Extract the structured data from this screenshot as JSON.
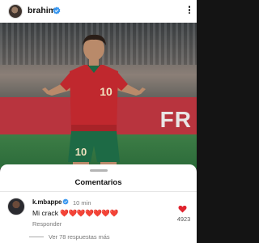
{
  "header": {
    "username": "brahim",
    "avatar_icon": "profile-avatar",
    "verified_icon": "verified-badge-icon",
    "more_icon": "more-vertical-icon"
  },
  "photo": {
    "board_text": "FR",
    "jersey_number": "10",
    "shorts_number": "10"
  },
  "comments": {
    "title": "Comentarios",
    "items": [
      {
        "user": "k.mbappe",
        "verified": true,
        "time": "10 min",
        "text": "Mi crack",
        "hearts": "❤️❤️❤️❤️❤️❤️❤️",
        "reply_label": "Responder",
        "likes": "4923"
      }
    ],
    "view_more": "Ver 78 respuestas más"
  },
  "colors": {
    "accent_blue": "#3897f0",
    "heart_red": "#e0242f",
    "board_red": "#b8343e",
    "jersey_red": "#c0282e",
    "shorts_green": "#1d6a45"
  }
}
